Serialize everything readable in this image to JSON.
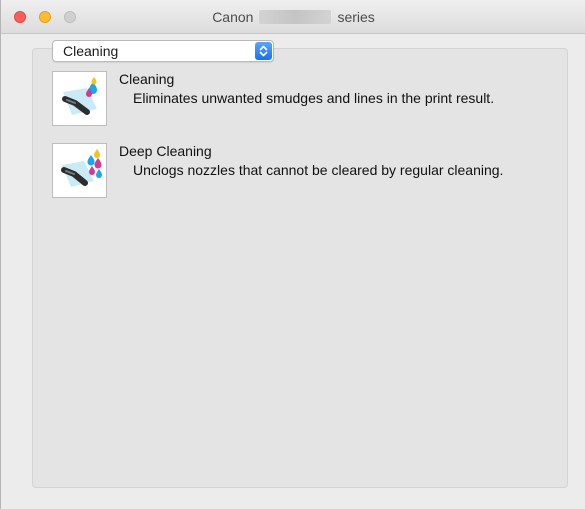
{
  "window": {
    "title_prefix": "Canon",
    "title_suffix": "series"
  },
  "popup": {
    "selected": "Cleaning"
  },
  "items": [
    {
      "title": "Cleaning",
      "description": "Eliminates unwanted smudges and lines in the print result.",
      "icon": "print-head-cleaning-icon"
    },
    {
      "title": "Deep Cleaning",
      "description": "Unclogs nozzles that cannot be cleared by regular cleaning.",
      "icon": "deep-cleaning-icon"
    }
  ],
  "colors": {
    "close_button": "#fc5f57",
    "minimize_button": "#fdbc2e",
    "zoom_button_inactive": "#d0d0d0",
    "popup_stepper": "#1772f0",
    "ink_cyan": "#1aa6e8",
    "ink_magenta": "#d63a8f",
    "ink_yellow": "#f2c518"
  }
}
